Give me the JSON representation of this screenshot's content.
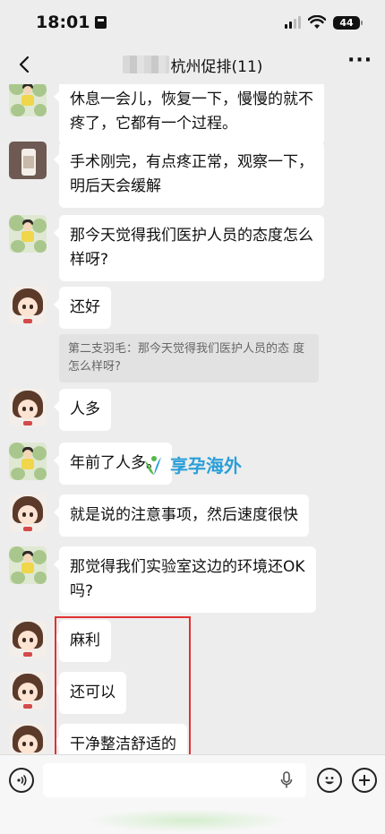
{
  "status_bar": {
    "time": "18:01",
    "battery": "44"
  },
  "nav": {
    "title": "杭州促排(11)"
  },
  "messages": [
    {
      "text": "休息一会儿，恢复一下，慢慢的就不\n疼了，它都有一个过程。"
    },
    {
      "text": "手术刚完，有点疼正常，观察一下，\n明后天会缓解"
    },
    {
      "text": "那今天觉得我们医护人员的态度怎么\n样呀?"
    },
    {
      "text": "还好",
      "quote": "第二支羽毛：那今天觉得我们医护人员的态\n度怎么样呀?"
    },
    {
      "text": "人多"
    },
    {
      "text": "年前了人多。"
    },
    {
      "text": "就是说的注意事项，然后速度很快"
    },
    {
      "text": "那觉得我们实验室这边的环境还OK\n吗?"
    },
    {
      "text": "麻利"
    },
    {
      "text": "还可以"
    },
    {
      "text": "干净整洁舒适的"
    }
  ],
  "watermark": {
    "text": "享孕海外"
  },
  "colors": {
    "highlight": "#e03131",
    "watermark": "#2a9fd8",
    "background": "#ededed"
  }
}
